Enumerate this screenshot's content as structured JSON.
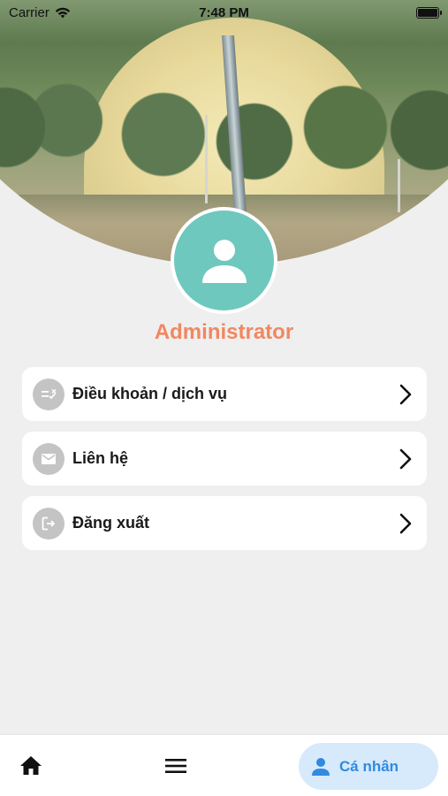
{
  "status_bar": {
    "carrier": "Carrier",
    "time": "7:48 PM"
  },
  "profile": {
    "name": "Administrator",
    "avatar_icon": "person-icon",
    "avatar_color": "#6fc8bd",
    "name_color": "#f2875f"
  },
  "menu": {
    "items": [
      {
        "label": "Điều khoản / dịch vụ",
        "icon": "terms-icon"
      },
      {
        "label": "Liên hệ",
        "icon": "mail-icon"
      },
      {
        "label": "Đăng xuất",
        "icon": "logout-icon"
      }
    ]
  },
  "bottom_nav": {
    "home_icon": "home-icon",
    "menu_icon": "hamburger-menu-icon",
    "profile_label": "Cá nhân",
    "active_color": "#2f8ae0",
    "active_bg": "#d6eafc"
  }
}
